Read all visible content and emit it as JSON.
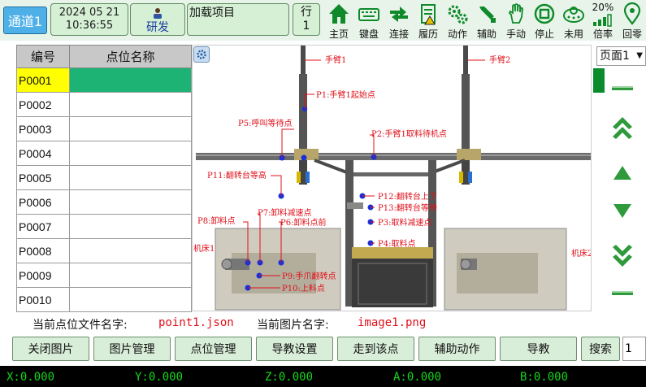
{
  "topbar": {
    "channel": "通道1",
    "date": "2024 05 21",
    "time": "10:36:55",
    "user": "研发",
    "project": "加载项目",
    "row_label": "行",
    "row_value": "1",
    "tools": [
      {
        "label": "主页",
        "icon": "home-icon"
      },
      {
        "label": "键盘",
        "icon": "keyboard-icon"
      },
      {
        "label": "连接",
        "icon": "connect-icon"
      },
      {
        "label": "履历",
        "icon": "history-icon"
      },
      {
        "label": "动作",
        "icon": "gear-icon"
      },
      {
        "label": "辅助",
        "icon": "assist-icon"
      },
      {
        "label": "手动",
        "icon": "hand-icon"
      },
      {
        "label": "停止",
        "icon": "stop-icon"
      },
      {
        "label": "未用",
        "icon": "unused-icon"
      },
      {
        "label": "倍率",
        "icon": "rate-icon"
      },
      {
        "label": "回零",
        "icon": "home-point-icon"
      }
    ],
    "rate_value": "20%",
    "accent": "#0f8a2a"
  },
  "table": {
    "headers": [
      "编号",
      "点位名称"
    ],
    "rows": [
      {
        "id": "P0001",
        "name": ""
      },
      {
        "id": "P0002",
        "name": ""
      },
      {
        "id": "P0003",
        "name": ""
      },
      {
        "id": "P0004",
        "name": ""
      },
      {
        "id": "P0005",
        "name": ""
      },
      {
        "id": "P0006",
        "name": ""
      },
      {
        "id": "P0007",
        "name": ""
      },
      {
        "id": "P0008",
        "name": ""
      },
      {
        "id": "P0009",
        "name": ""
      },
      {
        "id": "P0010",
        "name": ""
      }
    ],
    "selected_color": "#ffff00",
    "selected_name_color": "#1cb374"
  },
  "diagram": {
    "labels": {
      "arm1": "手臂1",
      "arm2": "手臂2",
      "p1": "P1:手臂1起始点",
      "p2": "P2:手臂1取料待机点",
      "p5": "P5:呼叫等待点",
      "p11": "P11:翻转台等高",
      "p12": "P12:翻转台上下",
      "p13": "P13:翻转台等待",
      "p3": "P3:取料减速点",
      "p4": "P4:取料点",
      "p7": "P7:卸料减速点",
      "p8": "P8:卸料点",
      "p6": "P6:卸料点前",
      "p9": "P9:手爪翻转点",
      "p10": "P10:上料点",
      "machine1": "机床1",
      "machine2": "机床2"
    }
  },
  "right": {
    "page_select": "页面1"
  },
  "info": {
    "file_label": "当前点位文件名字:",
    "file_value": "point1.json",
    "image_label": "当前图片名字:",
    "image_value": "image1.png"
  },
  "buttons": {
    "close_image": "关闭图片",
    "image_manage": "图片管理",
    "point_manage": "点位管理",
    "teach_settings": "导教设置",
    "goto_point": "走到该点",
    "aux_action": "辅助动作",
    "teach": "导教",
    "search": "搜索",
    "search_value": "1"
  },
  "status": {
    "x": "X:0.000",
    "y": "Y:0.000",
    "z": "Z:0.000",
    "a": "A:0.000",
    "b": "B:0.000"
  }
}
